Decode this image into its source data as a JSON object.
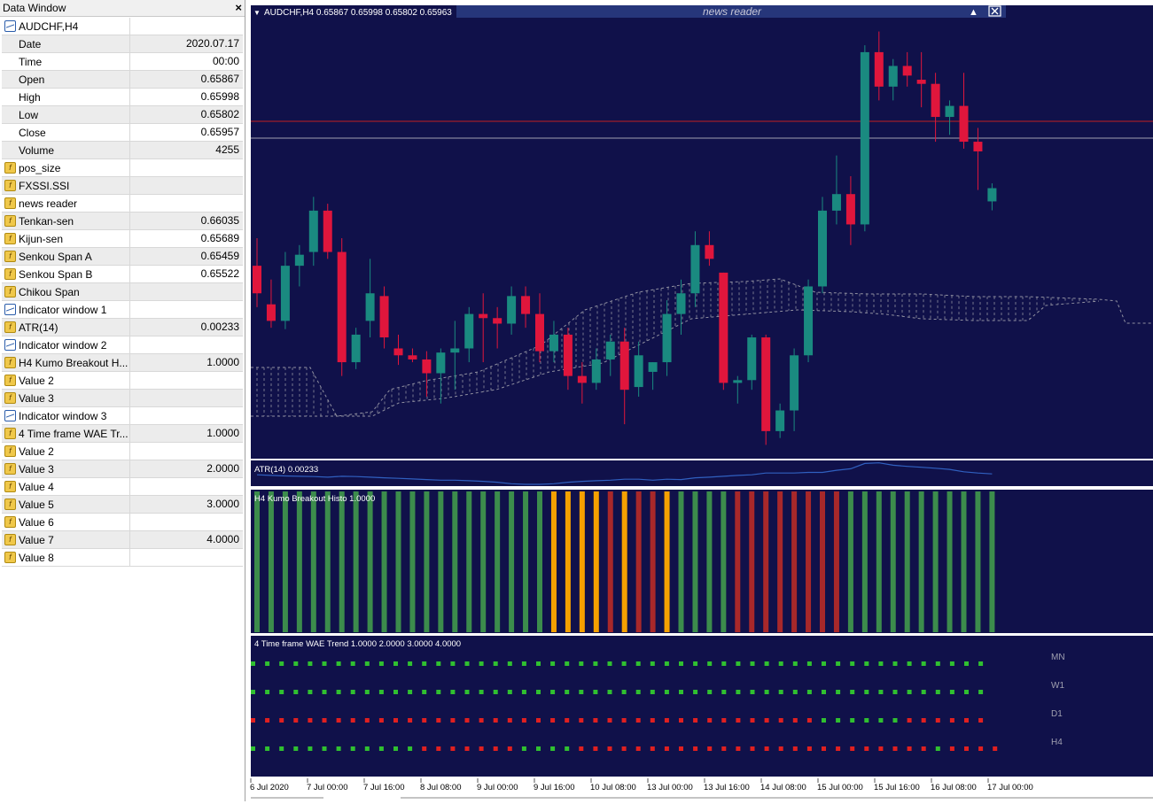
{
  "data_window": {
    "title": "Data Window",
    "close_glyph": "×",
    "rows": [
      {
        "icon": "chart",
        "name": "AUDCHF,H4",
        "value": ""
      },
      {
        "icon": "none",
        "name": "Date",
        "value": "2020.07.17"
      },
      {
        "icon": "none",
        "name": "Time",
        "value": "00:00"
      },
      {
        "icon": "none",
        "name": "Open",
        "value": "0.65867"
      },
      {
        "icon": "none",
        "name": "High",
        "value": "0.65998"
      },
      {
        "icon": "none",
        "name": "Low",
        "value": "0.65802"
      },
      {
        "icon": "none",
        "name": "Close",
        "value": "0.65957"
      },
      {
        "icon": "none",
        "name": "Volume",
        "value": "4255"
      },
      {
        "icon": "ind",
        "name": "pos_size",
        "value": ""
      },
      {
        "icon": "ind",
        "name": "FXSSI.SSI",
        "value": ""
      },
      {
        "icon": "ind",
        "name": "news reader",
        "value": ""
      },
      {
        "icon": "ind",
        "name": "Tenkan-sen",
        "value": "0.66035"
      },
      {
        "icon": "ind",
        "name": "Kijun-sen",
        "value": "0.65689"
      },
      {
        "icon": "ind",
        "name": "Senkou Span A",
        "value": "0.65459"
      },
      {
        "icon": "ind",
        "name": "Senkou Span B",
        "value": "0.65522"
      },
      {
        "icon": "ind",
        "name": "Chikou Span",
        "value": ""
      },
      {
        "icon": "chart",
        "name": "Indicator window 1",
        "value": ""
      },
      {
        "icon": "ind",
        "name": "ATR(14)",
        "value": "0.00233"
      },
      {
        "icon": "chart",
        "name": "Indicator window 2",
        "value": ""
      },
      {
        "icon": "ind",
        "name": "H4 Kumo Breakout H...",
        "value": "1.0000"
      },
      {
        "icon": "ind",
        "name": "Value 2",
        "value": ""
      },
      {
        "icon": "ind",
        "name": "Value 3",
        "value": ""
      },
      {
        "icon": "chart",
        "name": "Indicator window 3",
        "value": ""
      },
      {
        "icon": "ind",
        "name": "4 Time frame WAE Tr...",
        "value": "1.0000"
      },
      {
        "icon": "ind",
        "name": "Value 2",
        "value": ""
      },
      {
        "icon": "ind",
        "name": "Value 3",
        "value": "2.0000"
      },
      {
        "icon": "ind",
        "name": "Value 4",
        "value": ""
      },
      {
        "icon": "ind",
        "name": "Value 5",
        "value": "3.0000"
      },
      {
        "icon": "ind",
        "name": "Value 6",
        "value": ""
      },
      {
        "icon": "ind",
        "name": "Value 7",
        "value": "4.0000"
      },
      {
        "icon": "ind",
        "name": "Value 8",
        "value": ""
      }
    ]
  },
  "chart": {
    "header": "AUDCHF,H4  0.65867 0.65998 0.65802 0.65963",
    "news_reader": "news reader",
    "atr_label": "ATR(14) 0.00233",
    "histo_label": "H4 Kumo Breakout Histo 1.0000",
    "wae_label": "4 Time frame WAE Trend 1.0000 2.0000 3.0000 4.0000",
    "timeframes": [
      "MN",
      "W1",
      "D1",
      "H4"
    ],
    "time_labels": [
      "6 Jul 2020",
      "7 Jul 00:00",
      "7 Jul 16:00",
      "8 Jul 08:00",
      "9 Jul 00:00",
      "9 Jul 16:00",
      "10 Jul 08:00",
      "13 Jul 00:00",
      "13 Jul 16:00",
      "14 Jul 08:00",
      "15 Jul 00:00",
      "15 Jul 16:00",
      "16 Jul 08:00",
      "17 Jul 00:00"
    ],
    "colors": {
      "background": "#10114a",
      "bull": "#1a8a80",
      "bear": "#e0163c",
      "hist_green": "#3c8c4c",
      "hist_orange": "#f5a000",
      "hist_red": "#a8282a",
      "dot_green": "#30c030",
      "dot_red": "#e02020",
      "atr_line": "#3060c0",
      "hline_red": "#c02020",
      "hline_grey": "#a0a0b0",
      "cloud": "#9090a0"
    }
  },
  "chart_data": [
    {
      "type": "candlestick",
      "title": "AUDCHF,H4",
      "open_high_low_close_last": [
        0.65867,
        0.65998,
        0.65802,
        0.65963
      ],
      "candles": [
        {
          "o": 0.654,
          "h": 0.656,
          "l": 0.651,
          "c": 0.652
        },
        {
          "o": 0.6512,
          "h": 0.653,
          "l": 0.6495,
          "c": 0.65
        },
        {
          "o": 0.65,
          "h": 0.655,
          "l": 0.6494,
          "c": 0.654
        },
        {
          "o": 0.654,
          "h": 0.6555,
          "l": 0.6525,
          "c": 0.6548
        },
        {
          "o": 0.655,
          "h": 0.659,
          "l": 0.654,
          "c": 0.658
        },
        {
          "o": 0.658,
          "h": 0.6585,
          "l": 0.6545,
          "c": 0.655
        },
        {
          "o": 0.655,
          "h": 0.656,
          "l": 0.646,
          "c": 0.647
        },
        {
          "o": 0.647,
          "h": 0.6495,
          "l": 0.6465,
          "c": 0.649
        },
        {
          "o": 0.65,
          "h": 0.6545,
          "l": 0.6488,
          "c": 0.652
        },
        {
          "o": 0.6518,
          "h": 0.6525,
          "l": 0.648,
          "c": 0.6488
        },
        {
          "o": 0.648,
          "h": 0.649,
          "l": 0.6468,
          "c": 0.6475
        },
        {
          "o": 0.6475,
          "h": 0.648,
          "l": 0.647,
          "c": 0.6472
        },
        {
          "o": 0.6472,
          "h": 0.6478,
          "l": 0.6445,
          "c": 0.6462
        },
        {
          "o": 0.6462,
          "h": 0.648,
          "l": 0.644,
          "c": 0.6477
        },
        {
          "o": 0.6477,
          "h": 0.65,
          "l": 0.645,
          "c": 0.648
        },
        {
          "o": 0.648,
          "h": 0.651,
          "l": 0.647,
          "c": 0.6505
        },
        {
          "o": 0.6505,
          "h": 0.652,
          "l": 0.647,
          "c": 0.6502
        },
        {
          "o": 0.6502,
          "h": 0.651,
          "l": 0.648,
          "c": 0.6498
        },
        {
          "o": 0.6498,
          "h": 0.6525,
          "l": 0.649,
          "c": 0.6518
        },
        {
          "o": 0.6518,
          "h": 0.6525,
          "l": 0.6495,
          "c": 0.6505
        },
        {
          "o": 0.6505,
          "h": 0.652,
          "l": 0.647,
          "c": 0.6478
        },
        {
          "o": 0.6478,
          "h": 0.65,
          "l": 0.647,
          "c": 0.649
        },
        {
          "o": 0.649,
          "h": 0.6495,
          "l": 0.645,
          "c": 0.646
        },
        {
          "o": 0.646,
          "h": 0.647,
          "l": 0.644,
          "c": 0.6455
        },
        {
          "o": 0.6455,
          "h": 0.648,
          "l": 0.645,
          "c": 0.6472
        },
        {
          "o": 0.6472,
          "h": 0.649,
          "l": 0.646,
          "c": 0.6485
        },
        {
          "o": 0.6485,
          "h": 0.6495,
          "l": 0.6425,
          "c": 0.645
        },
        {
          "o": 0.6452,
          "h": 0.6485,
          "l": 0.6445,
          "c": 0.6475
        },
        {
          "o": 0.6463,
          "h": 0.647,
          "l": 0.645,
          "c": 0.647
        },
        {
          "o": 0.647,
          "h": 0.6515,
          "l": 0.646,
          "c": 0.6505
        },
        {
          "o": 0.6505,
          "h": 0.653,
          "l": 0.649,
          "c": 0.652
        },
        {
          "o": 0.652,
          "h": 0.6565,
          "l": 0.651,
          "c": 0.6555
        },
        {
          "o": 0.6555,
          "h": 0.6565,
          "l": 0.654,
          "c": 0.6545
        },
        {
          "o": 0.6535,
          "h": 0.6535,
          "l": 0.645,
          "c": 0.6455
        },
        {
          "o": 0.6455,
          "h": 0.646,
          "l": 0.644,
          "c": 0.6457
        },
        {
          "o": 0.6457,
          "h": 0.649,
          "l": 0.645,
          "c": 0.6488
        },
        {
          "o": 0.6488,
          "h": 0.649,
          "l": 0.641,
          "c": 0.642
        },
        {
          "o": 0.642,
          "h": 0.644,
          "l": 0.6415,
          "c": 0.6435
        },
        {
          "o": 0.6435,
          "h": 0.648,
          "l": 0.642,
          "c": 0.6475
        },
        {
          "o": 0.6475,
          "h": 0.653,
          "l": 0.647,
          "c": 0.6525
        },
        {
          "o": 0.6525,
          "h": 0.659,
          "l": 0.652,
          "c": 0.658
        },
        {
          "o": 0.658,
          "h": 0.662,
          "l": 0.657,
          "c": 0.6592
        },
        {
          "o": 0.6592,
          "h": 0.6605,
          "l": 0.6555,
          "c": 0.657
        },
        {
          "o": 0.657,
          "h": 0.67,
          "l": 0.6565,
          "c": 0.6695
        },
        {
          "o": 0.6695,
          "h": 0.671,
          "l": 0.666,
          "c": 0.667
        },
        {
          "o": 0.667,
          "h": 0.669,
          "l": 0.666,
          "c": 0.6685
        },
        {
          "o": 0.6685,
          "h": 0.6695,
          "l": 0.667,
          "c": 0.6678
        },
        {
          "o": 0.6675,
          "h": 0.6695,
          "l": 0.6655,
          "c": 0.6672
        },
        {
          "o": 0.6672,
          "h": 0.668,
          "l": 0.663,
          "c": 0.6648
        },
        {
          "o": 0.6648,
          "h": 0.666,
          "l": 0.6635,
          "c": 0.6656
        },
        {
          "o": 0.6656,
          "h": 0.668,
          "l": 0.6625,
          "c": 0.663
        },
        {
          "o": 0.663,
          "h": 0.664,
          "l": 0.6595,
          "c": 0.6623
        },
        {
          "o": 0.65867,
          "h": 0.65998,
          "l": 0.65802,
          "c": 0.65963
        }
      ],
      "horizontal_lines": [
        0.664,
        0.6648
      ]
    },
    {
      "type": "line",
      "title": "ATR(14) 0.00233",
      "values": [
        0.0023,
        0.00228,
        0.00226,
        0.00225,
        0.00224,
        0.00222,
        0.00225,
        0.00224,
        0.00222,
        0.0022,
        0.00218,
        0.00216,
        0.00214,
        0.00212,
        0.00212,
        0.0021,
        0.00208,
        0.00205,
        0.002,
        0.00198,
        0.00198,
        0.002,
        0.00205,
        0.00208,
        0.0021,
        0.00212,
        0.00215,
        0.00215,
        0.00212,
        0.00215,
        0.00214,
        0.0022,
        0.00222,
        0.00225,
        0.00228,
        0.0023,
        0.00236,
        0.00236,
        0.00236,
        0.00238,
        0.00238,
        0.00245,
        0.0025,
        0.00268,
        0.0027,
        0.00262,
        0.00258,
        0.00255,
        0.00252,
        0.00248,
        0.0024,
        0.00236,
        0.00233
      ]
    },
    {
      "type": "bar",
      "title": "H4 Kumo Breakout Histo 1.0000",
      "colors": [
        "g",
        "g",
        "g",
        "g",
        "g",
        "g",
        "g",
        "g",
        "g",
        "g",
        "g",
        "g",
        "g",
        "g",
        "g",
        "g",
        "g",
        "g",
        "g",
        "g",
        "g",
        "o",
        "o",
        "o",
        "o",
        "r",
        "o",
        "r",
        "r",
        "o",
        "g",
        "g",
        "g",
        "g",
        "r",
        "r",
        "r",
        "r",
        "r",
        "r",
        "r",
        "r",
        "g",
        "g",
        "g",
        "g",
        "g",
        "g",
        "g",
        "g",
        "g",
        "g",
        "g"
      ],
      "values": [
        1,
        1,
        1,
        1,
        1,
        1,
        1,
        1,
        1,
        1,
        1,
        1,
        1,
        1,
        1,
        1,
        1,
        1,
        1,
        1,
        1,
        1,
        1,
        1,
        1,
        1,
        1,
        1,
        1,
        1,
        1,
        1,
        1,
        1,
        1,
        1,
        1,
        1,
        1,
        1,
        1,
        1,
        1,
        1,
        1,
        1,
        1,
        1,
        1,
        1,
        1,
        1,
        1
      ]
    },
    {
      "type": "heatmap",
      "title": "4 Time frame WAE Trend 1.0000 2.0000 3.0000 4.0000",
      "rows": [
        "MN",
        "W1",
        "D1",
        "H4"
      ],
      "states": {
        "MN": "gggggggggggggggggggggggggggggggggggggggggggggggggggg",
        "W1": "gggggggggggggggggggggggggggggggggggggggggggggggggggg",
        "D1": "rrrrrrrrrrrrrrrrrrrrrrrrrrrrrrrrrrrrrrrrggggggrrrrrr",
        "H4": "ggggggggggggrrrrrrrggggrrrrrrrrrrrrrrrrrrrrrrrrrgrrrr"
      }
    }
  ]
}
